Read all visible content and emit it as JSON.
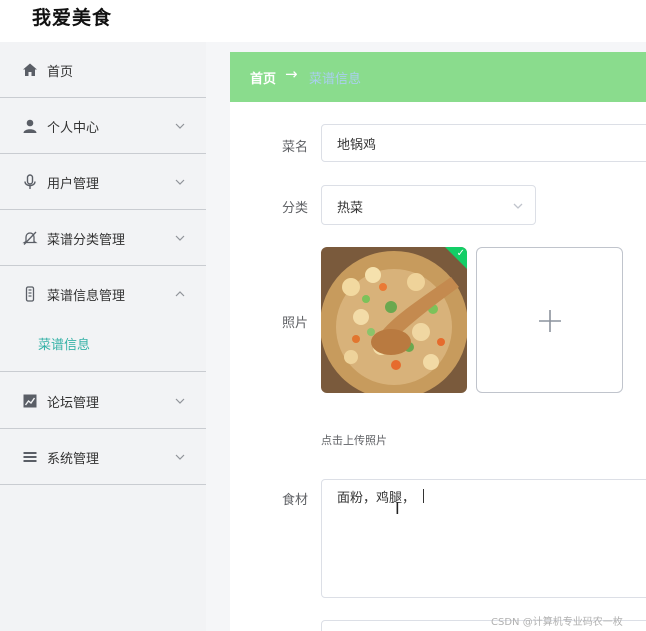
{
  "app": {
    "title": "我爱美食"
  },
  "sidebar": {
    "items": [
      {
        "label": "首页",
        "icon": "home-icon"
      },
      {
        "label": "个人中心",
        "icon": "user-icon"
      },
      {
        "label": "用户管理",
        "icon": "microphone-icon"
      },
      {
        "label": "菜谱分类管理",
        "icon": "bell-off-icon"
      },
      {
        "label": "菜谱信息管理",
        "icon": "phone-icon",
        "expanded": true
      },
      {
        "label": "论坛管理",
        "icon": "chart-icon"
      },
      {
        "label": "系统管理",
        "icon": "list-icon"
      }
    ],
    "submenu": {
      "label": "菜谱信息"
    }
  },
  "breadcrumb": {
    "home": "首页",
    "separator": "→",
    "current": "菜谱信息"
  },
  "form": {
    "name": {
      "label": "菜名",
      "value": "地锅鸡"
    },
    "category": {
      "label": "分类",
      "value": "热菜"
    },
    "photo": {
      "label": "照片",
      "upload_hint": "点击上传照片"
    },
    "ingredients": {
      "label": "食材",
      "value": "面粉，鸡腿，"
    }
  },
  "watermark": "CSDN @计算机专业码农一枚",
  "colors": {
    "breadcrumb_bg": "#8adc8d",
    "active_submenu": "#36b2a7",
    "success": "#13ce66"
  }
}
